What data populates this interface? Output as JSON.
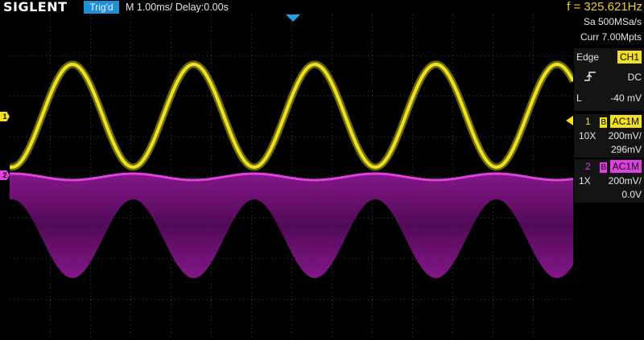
{
  "header": {
    "brand": "SIGLENT",
    "trigger_status": "Trig'd",
    "timebase": "M 1.00ms/ Delay:0.00s",
    "frequency": "f = 325.621Hz"
  },
  "acquisition": {
    "sample_rate": "Sa 500MSa/s",
    "memory_depth": "Curr 7.00Mpts"
  },
  "trigger": {
    "type_label": "Edge",
    "source": "CH1",
    "coupling": "DC",
    "level_label": "L",
    "level": "-40 mV"
  },
  "channel1": {
    "number": "1",
    "bw_badge": "B",
    "coupling": "AC1M",
    "probe": "10X",
    "scale": "200mV/",
    "offset": "296mV",
    "color": "#f0e020"
  },
  "channel2": {
    "number": "2",
    "bw_badge": "B",
    "coupling": "AC1M",
    "probe": "1X",
    "scale": "200mV/",
    "offset": "0.0V",
    "color": "#e040e0"
  },
  "markers": {
    "ch1": "1",
    "ch2": "2"
  }
}
